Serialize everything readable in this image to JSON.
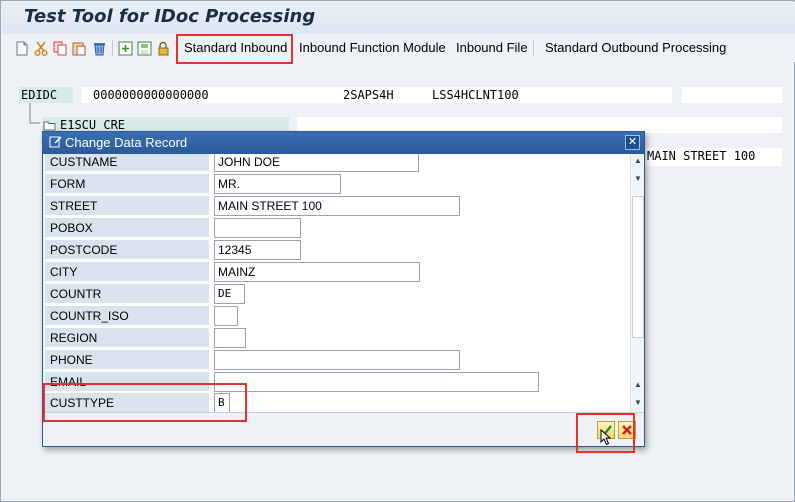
{
  "app": {
    "title": "Test Tool for IDoc Processing"
  },
  "toolbar": {
    "icons": [
      "new-icon",
      "cut-icon",
      "copy-icon",
      "paste-icon",
      "delete-icon",
      "insert-icon",
      "save-icon",
      "lock-icon"
    ],
    "buttons": {
      "standard_inbound": "Standard Inbound",
      "inbound_function_module": "Inbound Function Module",
      "inbound_file": "Inbound File",
      "standard_outbound": "Standard Outbound Processing"
    }
  },
  "tree": {
    "control_record": {
      "label": "EDIDC",
      "docnum": "0000000000000000",
      "sender": "2SAPS4H",
      "client": "LSS4HCLNT100"
    },
    "segment": {
      "label": "E1SCU_CRE",
      "value_peek": "MAIN STREET 100"
    }
  },
  "dialog": {
    "title": "Change Data Record",
    "fields": [
      {
        "label": "CUSTNAME",
        "value": "JOHN DOE"
      },
      {
        "label": "FORM",
        "value": "MR."
      },
      {
        "label": "STREET",
        "value": "MAIN STREET 100"
      },
      {
        "label": "POBOX",
        "value": ""
      },
      {
        "label": "POSTCODE",
        "value": "12345"
      },
      {
        "label": "CITY",
        "value": "MAINZ"
      },
      {
        "label": "COUNTR",
        "value": "DE"
      },
      {
        "label": "COUNTR_ISO",
        "value": ""
      },
      {
        "label": "REGION",
        "value": ""
      },
      {
        "label": "PHONE",
        "value": ""
      },
      {
        "label": "EMAIL",
        "value": ""
      },
      {
        "label": "CUSTTYPE",
        "value": "B"
      }
    ],
    "footer_actions": [
      "confirm-icon",
      "cancel-icon"
    ]
  },
  "colors": {
    "dialog_title_bg": "#2b5a99",
    "label_bg": "#d8e3ee",
    "highlight": "#e5322d",
    "app_bg": "#eef2f7"
  }
}
